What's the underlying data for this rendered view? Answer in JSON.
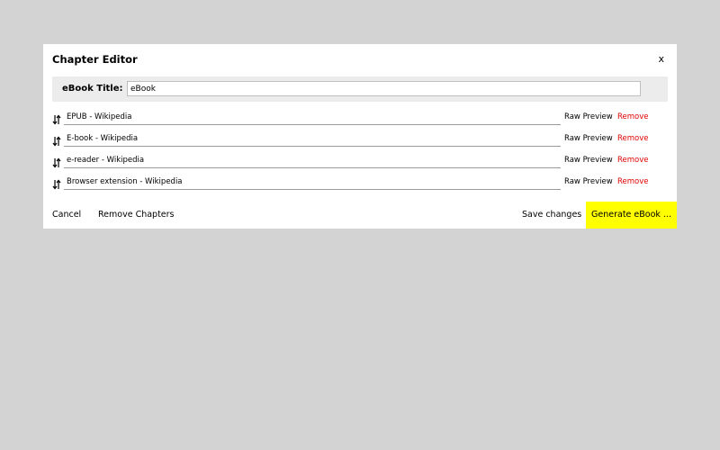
{
  "dialog": {
    "title": "Chapter Editor",
    "close_label": "x"
  },
  "ebook": {
    "label": "eBook Title:",
    "value": "eBook"
  },
  "chapters": [
    {
      "title": "EPUB - Wikipedia",
      "preview_label": "Raw Preview",
      "remove_label": "Remove"
    },
    {
      "title": "E-book - Wikipedia",
      "preview_label": "Raw Preview",
      "remove_label": "Remove"
    },
    {
      "title": "e-reader - Wikipedia",
      "preview_label": "Raw Preview",
      "remove_label": "Remove"
    },
    {
      "title": "Browser extension - Wikipedia",
      "preview_label": "Raw Preview",
      "remove_label": "Remove"
    }
  ],
  "footer": {
    "cancel_label": "Cancel",
    "remove_chapters_label": "Remove Chapters",
    "save_label": "Save changes",
    "generate_label": "Generate eBook ..."
  },
  "colors": {
    "remove_text": "#e00000",
    "generate_button": "#ffff00",
    "backdrop": "#d3d3d3"
  },
  "icons": {
    "drag_handle": "drag-handle-icon"
  }
}
